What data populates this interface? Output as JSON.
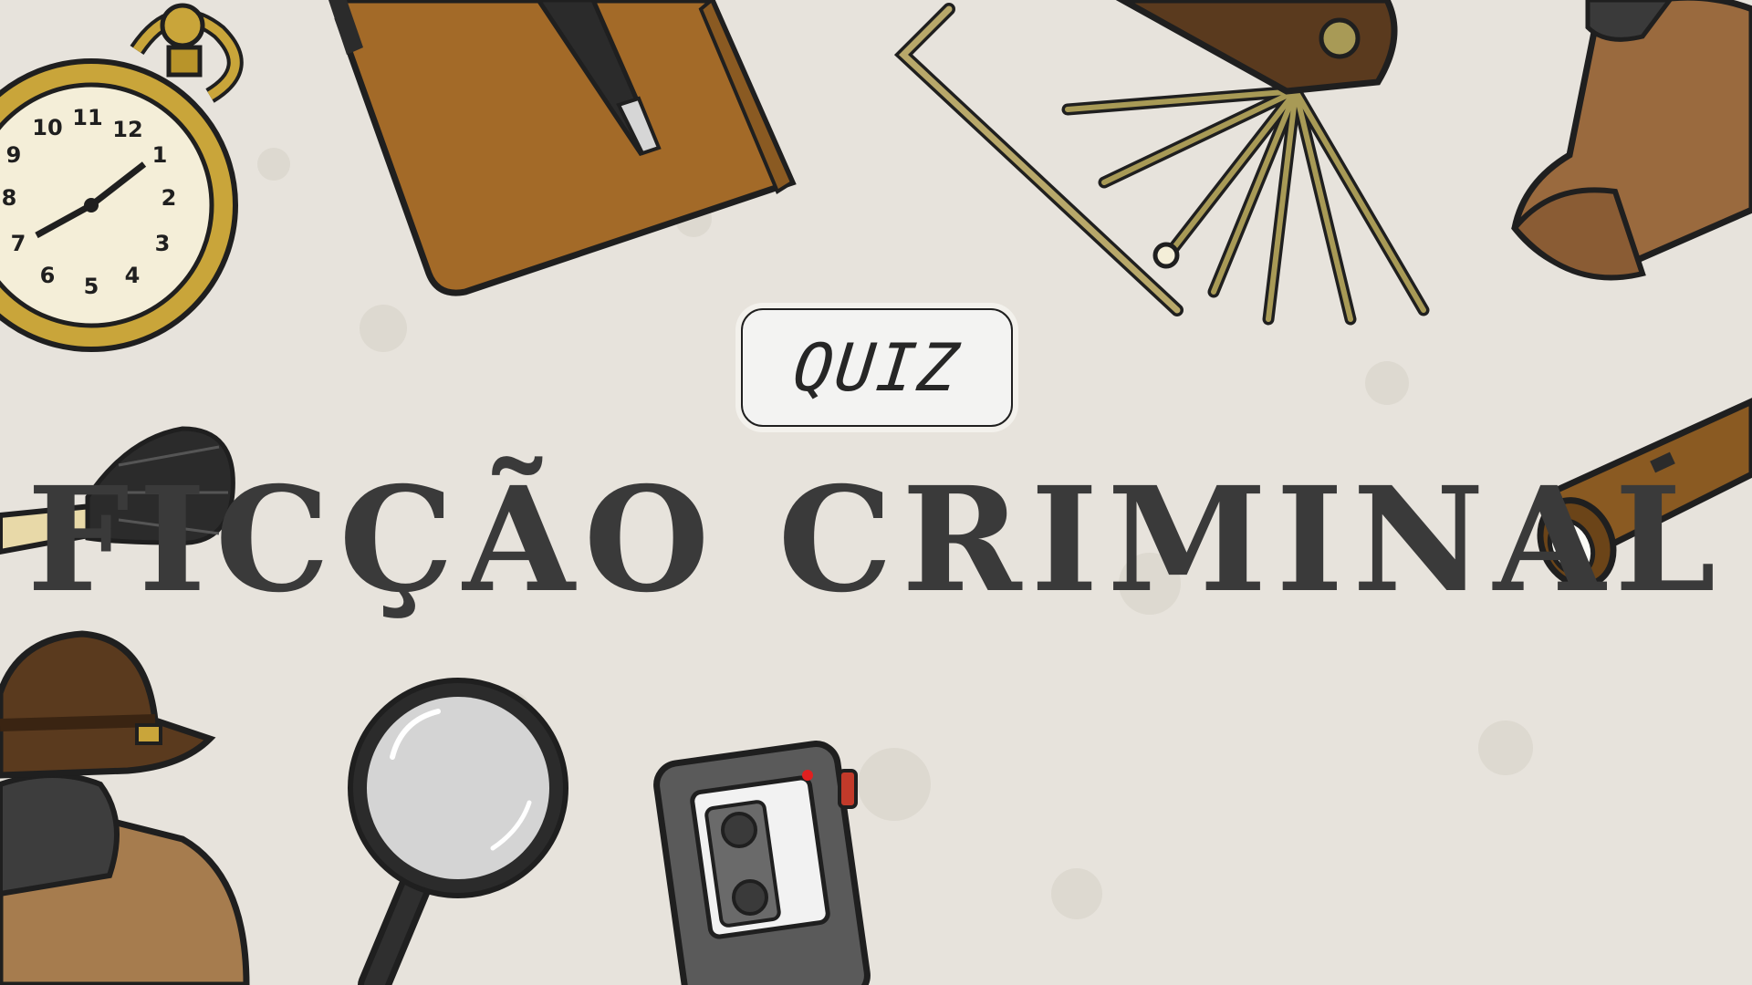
{
  "badge": {
    "label": "QUIZ"
  },
  "title": "FICÇÃO CRIMINAL",
  "icons": [
    "pocket-watch-icon",
    "notebook-icon",
    "pen-icon",
    "lockpick-set-icon",
    "detective-cap-icon",
    "powder-brush-icon",
    "flashlight-icon",
    "detective-figure-icon",
    "magnifying-glass-icon",
    "tape-recorder-icon"
  ],
  "colors": {
    "background": "#e7e3dc",
    "text": "#3a3a3a",
    "outline": "#1f1f1f",
    "brown": "#a36a28",
    "gold": "#b8942a"
  }
}
